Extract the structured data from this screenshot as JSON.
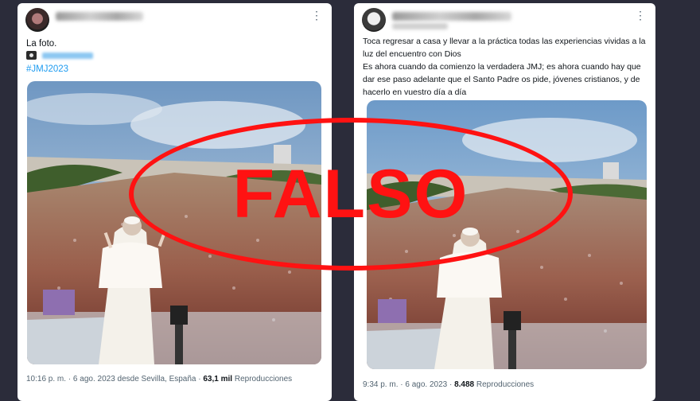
{
  "left_post": {
    "text_line1": "La foto.",
    "camera_icon": "camera-icon",
    "tagged_user": "",
    "hashtag": "#JMJ2023",
    "time": "10:16 p. m.",
    "date": "6 ago. 2023 desde Sevilla, España",
    "views_count": "63,1 mil",
    "views_label": "Reproducciones"
  },
  "right_post": {
    "text": "Toca regresar a casa y llevar a la práctica todas las experiencias vividas a la luz del encuentro con Dios",
    "text2": "Es ahora cuando da comienzo la verdadera JMJ; es ahora cuando hay que dar ese paso adelante que el Santo Padre os pide, jóvenes cristianos, y de hacerlo en vuestro día a día",
    "time": "9:34 p. m.",
    "date": "6 ago. 2023",
    "views_count": "8.488",
    "views_label": "Reproducciones"
  },
  "overlay": {
    "stamp_text": "FALSO",
    "color": "#ff1212"
  },
  "colors": {
    "background": "#2b2c3a",
    "link": "#1d9bf0",
    "secondary_text": "#536471"
  }
}
